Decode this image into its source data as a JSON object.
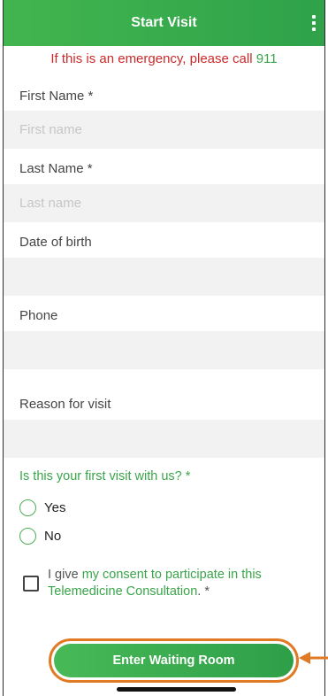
{
  "header": {
    "title": "Start Visit",
    "menu_icon": "more-vertical-icon"
  },
  "emergency": {
    "text": "If this is an emergency, please call ",
    "number": "911"
  },
  "fields": {
    "first_name": {
      "label": "First Name *",
      "placeholder": "First name"
    },
    "last_name": {
      "label": "Last Name *",
      "placeholder": "Last name"
    },
    "dob": {
      "label": "Date of birth",
      "placeholder": ""
    },
    "phone": {
      "label": "Phone",
      "placeholder": ""
    },
    "reason": {
      "label": "Reason for visit",
      "placeholder": ""
    }
  },
  "first_visit": {
    "question": "Is this your first visit with us? *",
    "options": [
      "Yes",
      "No"
    ]
  },
  "consent": {
    "prefix": "I give ",
    "link": "my consent to participate in this Telemedicine Consultation",
    "suffix": ". *"
  },
  "cta": {
    "label": "Enter Waiting Room"
  },
  "colors": {
    "brand_green": "#3aa54a",
    "emergency_red": "#cc2a2a",
    "highlight_orange": "#e07a24"
  }
}
